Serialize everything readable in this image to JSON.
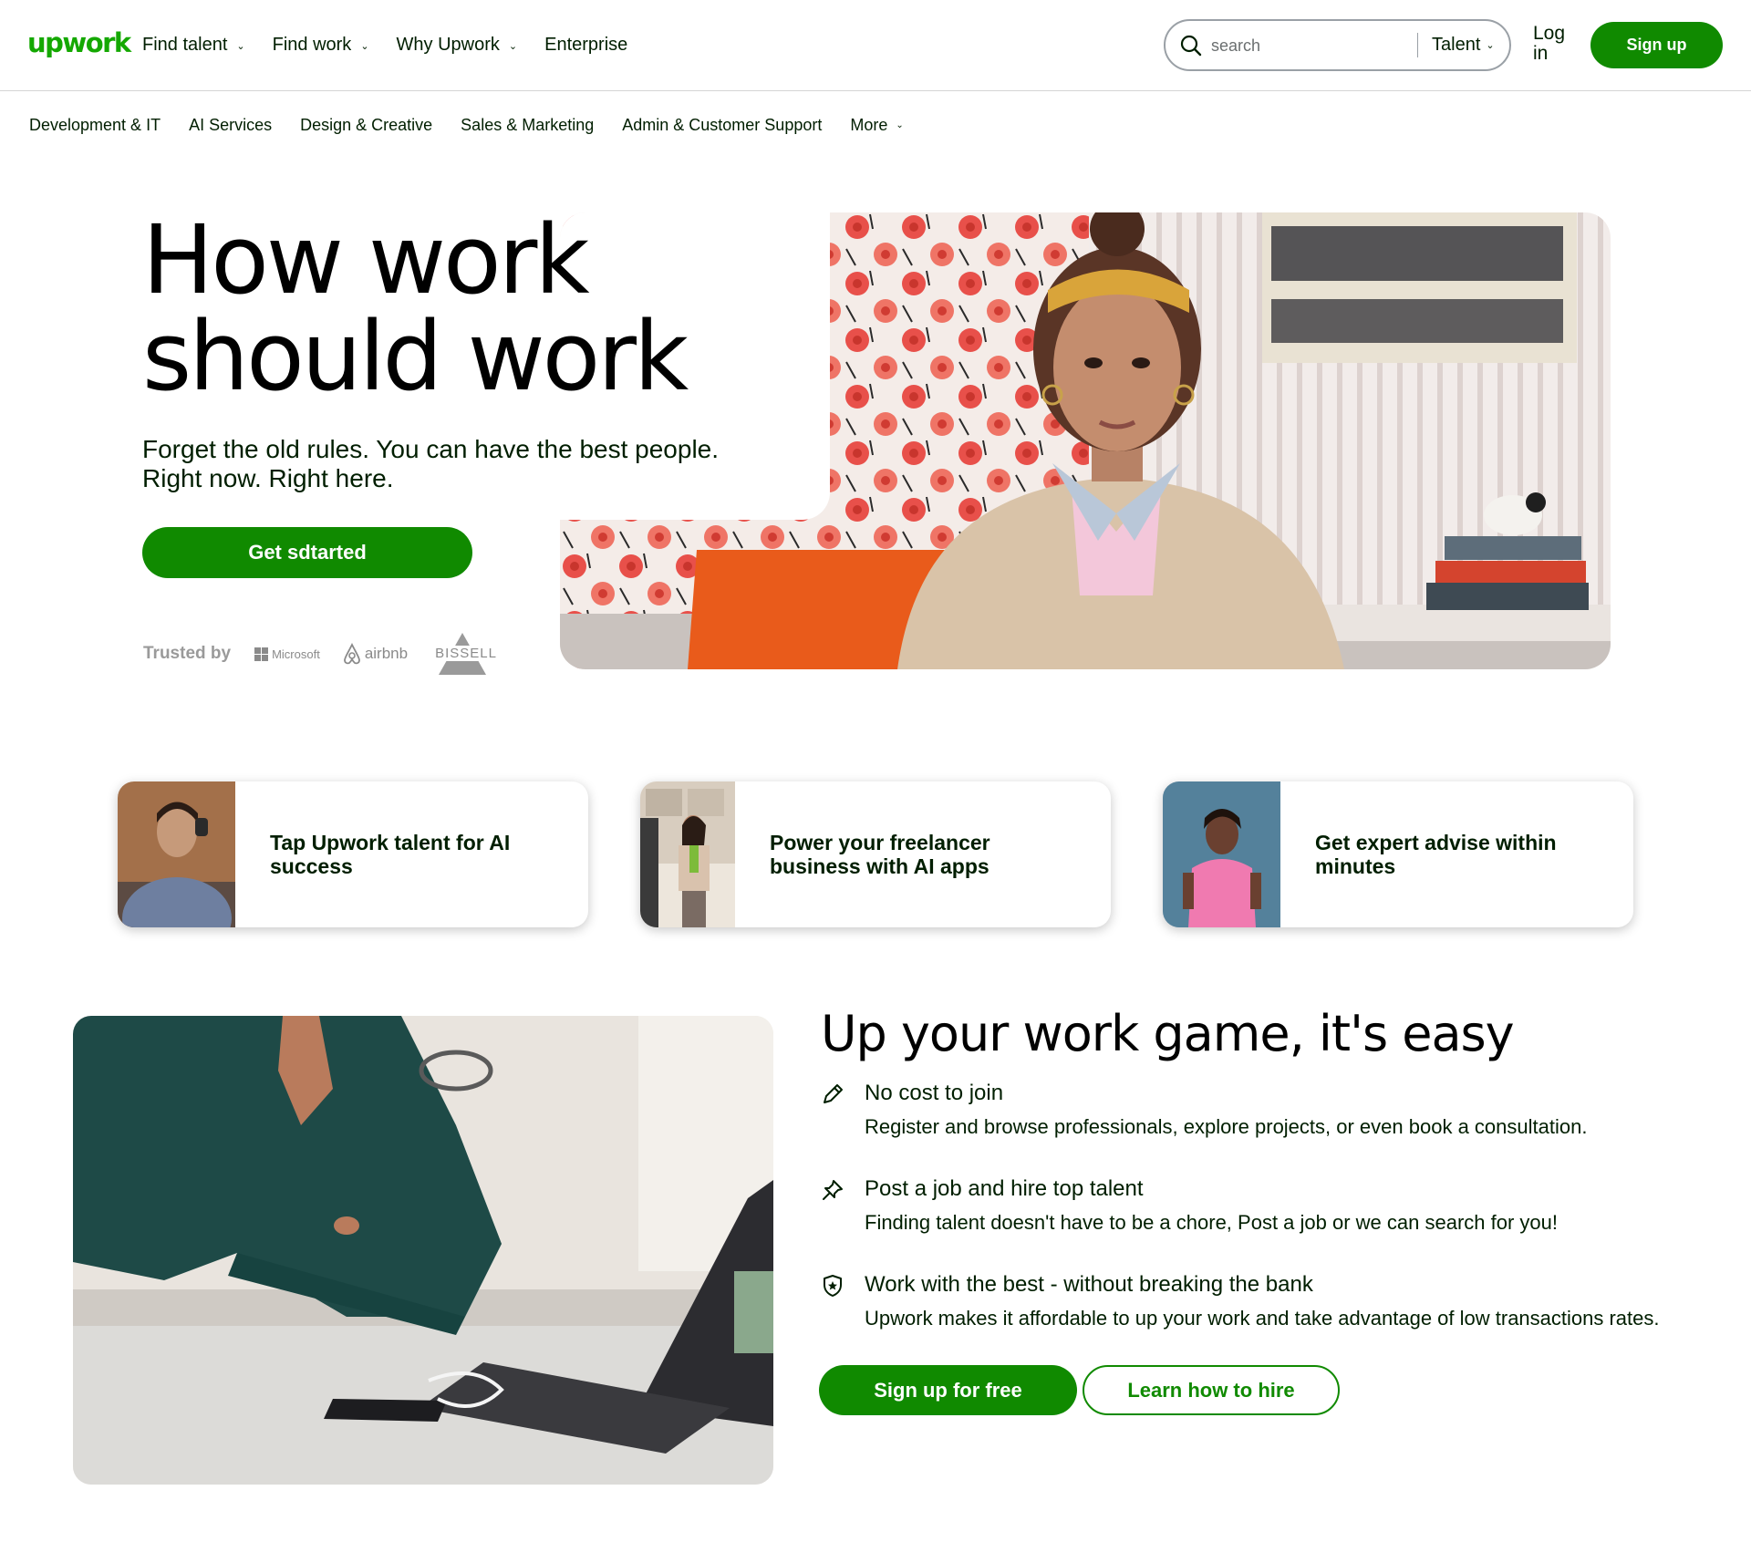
{
  "header": {
    "logo": "upwork",
    "nav": [
      "Find talent",
      "Find work",
      "Why Upwork",
      "Enterprise"
    ],
    "nav_has_chevron": [
      true,
      true,
      true,
      false
    ],
    "search": {
      "placeholder": "search",
      "scope": "Talent"
    },
    "login": "Log in",
    "signup": "Sign up"
  },
  "categories": [
    "Development & IT",
    "AI Services",
    "Design & Creative",
    "Sales & Marketing",
    "Admin & Customer Support",
    "More"
  ],
  "hero": {
    "title_line1": "How work",
    "title_line2": "should work",
    "subtitle_line1": "Forget the old rules. You can have the best people.",
    "subtitle_line2": "Right now. Right here.",
    "cta": "Get sdtarted",
    "trusted_label": "Trusted by",
    "trusted_logos": [
      "Microsoft",
      "airbnb",
      "BISSELL"
    ]
  },
  "cards": [
    {
      "text": "Tap Upwork talent for AI success"
    },
    {
      "text": "Power your freelancer business with AI apps"
    },
    {
      "text": "Get expert advise within minutes"
    }
  ],
  "section": {
    "title": "Up your work game, it's easy",
    "features": [
      {
        "icon": "pencil-icon",
        "title": "No cost to join",
        "desc": "Register and browse professionals, explore projects, or even book a consultation."
      },
      {
        "icon": "pin-icon",
        "title": "Post a job and hire top talent",
        "desc": "Finding talent doesn't have to be a chore, Post a job or we can search for you!"
      },
      {
        "icon": "shield-star-icon",
        "title": "Work with the best - without breaking the bank",
        "desc": "Upwork makes it affordable to up your work and take advantage of low transactions rates."
      }
    ],
    "btn_primary": "Sign up for free",
    "btn_secondary": "Learn how to hire"
  },
  "colors": {
    "brand_green": "#14a800",
    "button_green": "#108a00",
    "text": "#001e00"
  }
}
